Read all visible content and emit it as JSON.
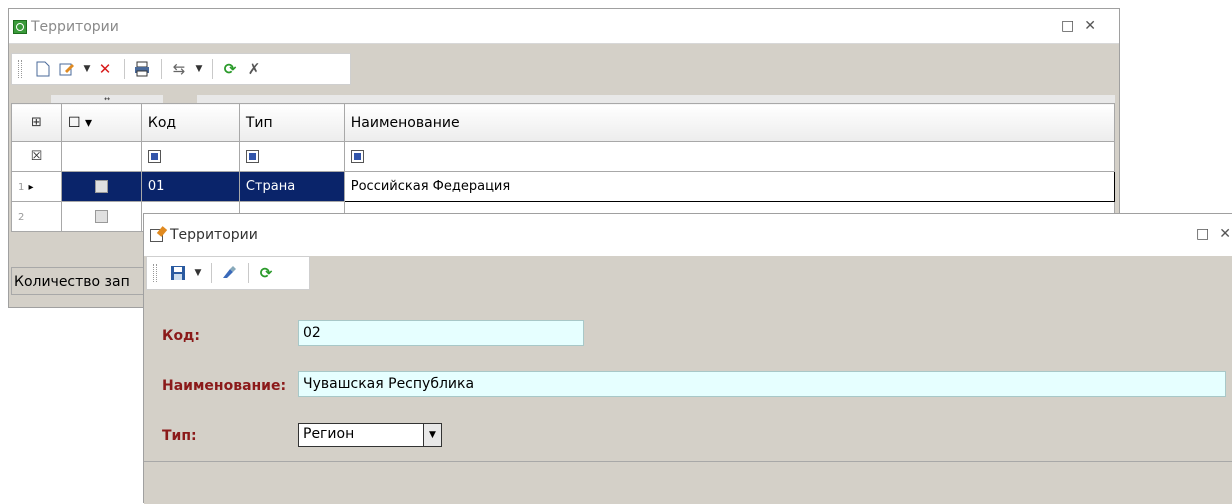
{
  "back_window": {
    "title": "Территории",
    "controls": {
      "restore": "□",
      "close": "✕"
    },
    "toolbar_icons": [
      "new-icon",
      "edit-icon",
      "delete-icon",
      "print-icon",
      "links-icon",
      "refresh-icon",
      "tools-icon"
    ],
    "column_band_label": "↔",
    "columns": [
      "",
      "☐ ▾",
      "Код",
      "Тип",
      "Наименование"
    ],
    "rows": [
      {
        "num": "1",
        "marker": "▸",
        "code": "01",
        "type": "Страна",
        "name": "Российская Федерация"
      },
      {
        "num": "2",
        "marker": "",
        "code": "",
        "type": "",
        "name": ""
      }
    ],
    "status_text": "Количество зап"
  },
  "front_window": {
    "title": "Территории",
    "controls": {
      "restore": "□",
      "close": "✕"
    },
    "toolbar_icons": [
      "save-icon",
      "dropdown-icon",
      "clear-icon",
      "refresh-icon"
    ],
    "form": {
      "code_label": "Код:",
      "code_value": "02",
      "name_label": "Наименование:",
      "name_value": "Чувашская Республика",
      "type_label": "Тип:",
      "type_value": "Регион"
    }
  },
  "colors": {
    "label_red": "#8b1a1a",
    "input_bg": "#e6ffff",
    "selection_bg": "#0a246a",
    "window_bg": "#d4d0c8"
  }
}
